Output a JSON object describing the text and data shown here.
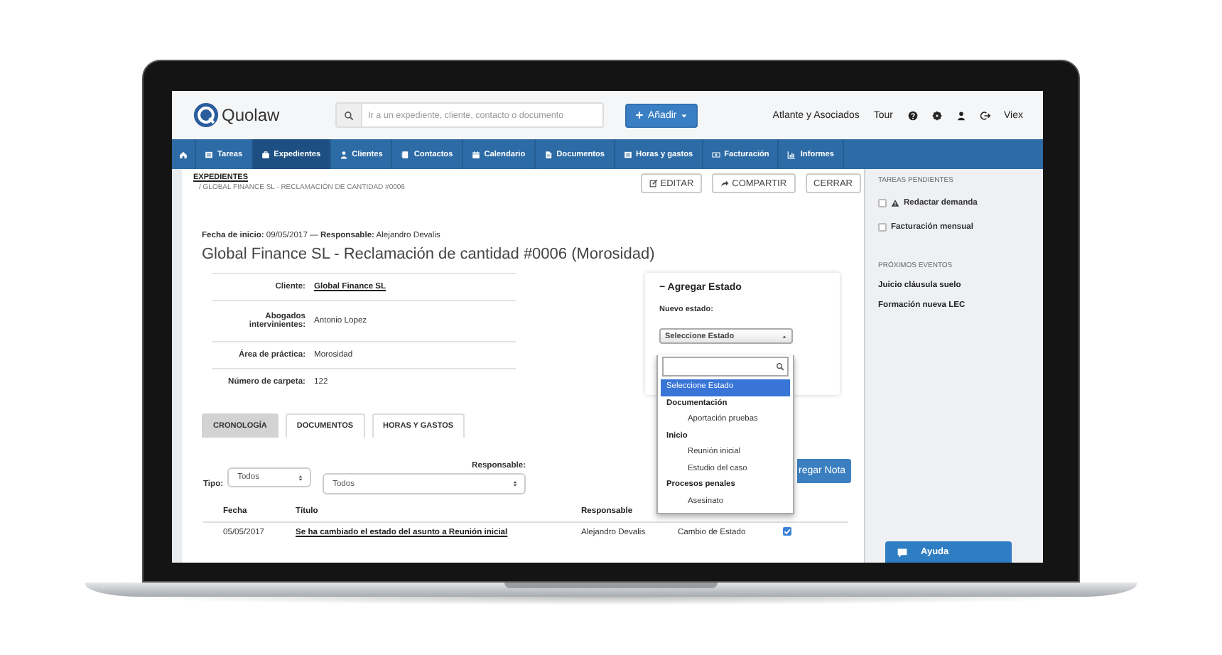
{
  "header": {
    "logo": "Quolaw",
    "search": {
      "placeholder": "Ir a un expediente, cliente, contacto o documento"
    },
    "add_button": "Añadir",
    "firm": "Atlante y Asociados",
    "tour": "Tour",
    "user": "Viex"
  },
  "nav": [
    {
      "label": "Tareas",
      "selected": false
    },
    {
      "label": "Expedientes",
      "selected": true
    },
    {
      "label": "Clientes",
      "selected": false
    },
    {
      "label": "Contactos",
      "selected": false
    },
    {
      "label": "Calendario",
      "selected": false
    },
    {
      "label": "Documentos",
      "selected": false
    },
    {
      "label": "Horas y gastos",
      "selected": false
    },
    {
      "label": "Facturación",
      "selected": false
    },
    {
      "label": "Informes",
      "selected": false
    }
  ],
  "breadcrumb": {
    "section": "EXPEDIENTES",
    "current": "/ GLOBAL FINANCE SL - RECLAMACIÓN DE CANTIDAD #0006"
  },
  "actions": [
    "EDITAR",
    "COMPARTIR",
    "CERRAR"
  ],
  "meta": "**Fecha de inicio:** 09/05/2017 — **Responsable:** Alejandro Devalis",
  "title": "Global Finance SL - Reclamación de cantidad #0006 (Morosidad)",
  "details": [
    {
      "label": "Cliente:",
      "value": "Global Finance SL",
      "kind": "link"
    },
    {
      "label": "Abogados intervinientes:",
      "value": "Antonio Lopez",
      "kind": "text"
    },
    {
      "label": "Área de práctica:",
      "value": "Morosidad",
      "kind": "text"
    },
    {
      "label": "Número de carpeta:",
      "value": "122",
      "kind": "text"
    }
  ],
  "state_panel": {
    "title": "− Agregar Estado",
    "label": "Nuevo estado:",
    "select": "Seleccione Estado",
    "options": [
      {
        "label": "Seleccione Estado",
        "kind": "option",
        "selected": true
      },
      {
        "label": "Documentación",
        "kind": "group",
        "children": [
          {
            "label": "Aportación pruebas",
            "kind": "option",
            "selected": false
          }
        ]
      },
      {
        "label": "Inicio",
        "kind": "group",
        "children": [
          {
            "label": "Reunión inicial",
            "kind": "option",
            "selected": false
          },
          {
            "label": "Estudio del caso",
            "kind": "option",
            "selected": false
          }
        ]
      },
      {
        "label": "Procesos penales",
        "kind": "group",
        "children": [
          {
            "label": "Asesinato",
            "kind": "option",
            "selected": false
          }
        ]
      }
    ]
  },
  "tabs": [
    {
      "label": "CRONOLOGÍA",
      "selected": true
    },
    {
      "label": "DOCUMENTOS",
      "selected": false
    },
    {
      "label": "HORAS Y GASTOS",
      "selected": false
    }
  ],
  "filters": {
    "tipo": {
      "label": "Tipo:",
      "value": "Todos"
    },
    "responsable": {
      "label": "Responsable:",
      "value": "Todos"
    }
  },
  "note_button": "regar Nota",
  "table": {
    "columns": [
      "Fecha",
      "Título",
      "Responsable"
    ],
    "rows": [
      {
        "fecha": "05/05/2017",
        "titulo": "Se ha cambiado el estado del asunto a Reunión inicial",
        "responsable": "Alejandro Devalis",
        "tipo": "Cambio de Estado",
        "checked": true
      }
    ]
  },
  "sidebar": {
    "tasks_title": "TAREAS PENDIENTES",
    "tasks": [
      {
        "label": "Redactar demanda",
        "checked": false,
        "warning": true
      },
      {
        "label": "Facturación mensual",
        "checked": false,
        "warning": false
      }
    ],
    "events_title": "PRÓXIMOS EVENTOS",
    "events": [
      "Juicio cláusula suelo",
      "Formación nueva LEC"
    ]
  },
  "help_button": "Ayuda"
}
